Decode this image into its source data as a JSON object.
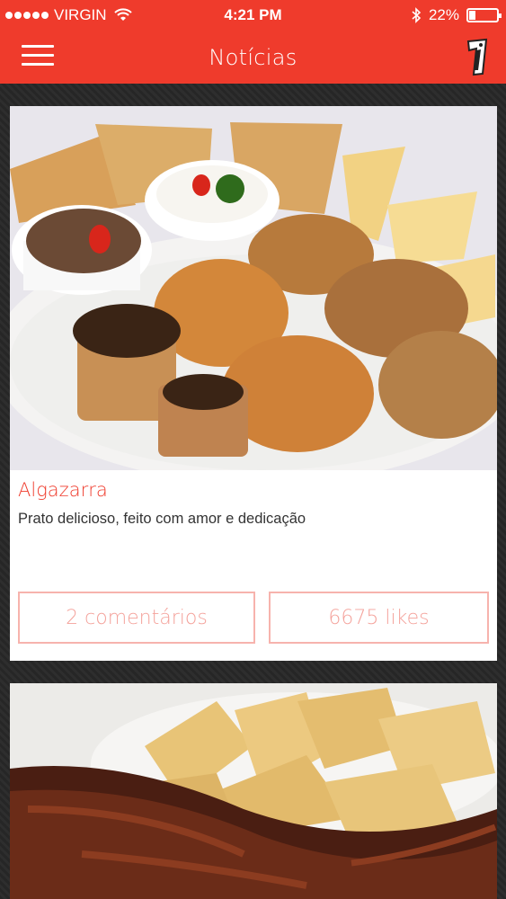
{
  "status_bar": {
    "carrier": "VIRGIN",
    "time": "4:21 PM",
    "battery_percent_label": "22%",
    "battery_level": 0.22
  },
  "header": {
    "title": "Notícias",
    "menu_icon": "hamburger-menu-icon",
    "logo_icon": "brand-logo-icon"
  },
  "colors": {
    "brand_red": "#ef3b2c",
    "button_border": "#f7b3ad",
    "button_text": "#f4a29b"
  },
  "posts": [
    {
      "title": "Algazarra",
      "description": "Prato delicioso, feito com amor e dedicação",
      "comments_label": "2 comentários",
      "likes_label": "6675 likes"
    }
  ]
}
